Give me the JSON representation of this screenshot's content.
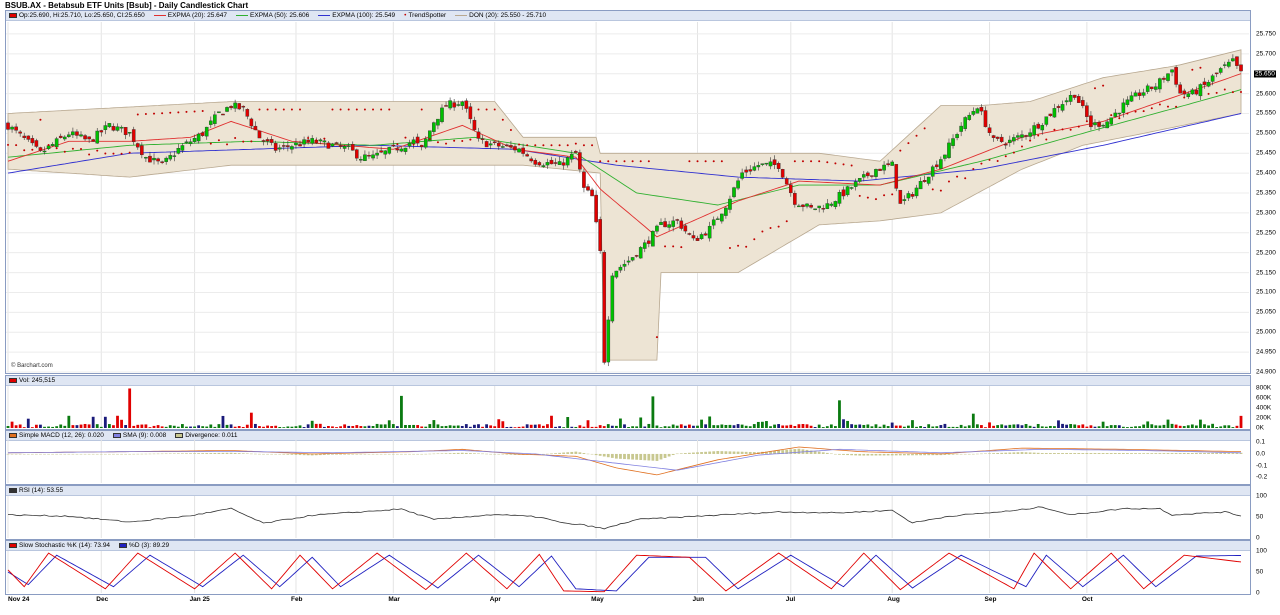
{
  "title": "BSUB.AX - Betabsub ETF Units [Bsub] - Daily Candlestick Chart",
  "legend_price": {
    "ohlc": "Op:25.690, Hi:25.710, Lo:25.650, Cl:25.650",
    "ema": "EXPMA (20): 25.647",
    "ema50": "EXPMA (50): 25.606",
    "ema100": "EXPMA (100): 25.549",
    "trend": "TrendSpotter",
    "don": "DON (20): 25.550 - 25.710"
  },
  "legend_vol": "Vol: 245,515",
  "legend_macd": {
    "macd": "Simple MACD (12, 26): 0.020",
    "sma": "SMA (9): 0.008",
    "div": "Divergence: 0.011"
  },
  "legend_rsi": "RSI (14): 53.55",
  "legend_stoch": {
    "k": "Slow Stochastic %K (14): 73.94",
    "d": "%D (3): 89.29"
  },
  "credit": "© Barchart.com",
  "last_price_label": "25.650",
  "colors": {
    "up": "#00c000",
    "down": "#e00000",
    "ema20": "#e03030",
    "ema50": "#30b030",
    "ema100": "#3030d0",
    "donchian_fill": "#ede4d4",
    "donchian_line": "#b8a890",
    "sar": "#c00000",
    "vol_neutral": "#0a7a10",
    "vol_navy": "#1a1a7a",
    "macd_hist": "#c8c890",
    "macd_line": "#e07020",
    "macd_sig": "#8080e0",
    "rsi": "#333333",
    "stoch_k": "#e00000",
    "stoch_d": "#2020c0"
  },
  "axes": {
    "price_ticks": [
      "25.750",
      "25.700",
      "25.650",
      "25.600",
      "25.550",
      "25.500",
      "25.450",
      "25.400",
      "25.350",
      "25.300",
      "25.250",
      "25.200",
      "25.150",
      "25.100",
      "25.050",
      "25.000",
      "24.950",
      "24.900"
    ],
    "vol_ticks": [
      "800K",
      "600K",
      "400K",
      "200K",
      "0K"
    ],
    "macd_ticks": [
      "0.1",
      "0.0",
      "-0.1",
      "-0.2"
    ],
    "rsi_ticks": [
      "100",
      "50",
      "0"
    ],
    "stoch_ticks": [
      "100",
      "50",
      "0"
    ],
    "x_labels": [
      "Nov 24",
      "Dec",
      "Jan 25",
      "Feb",
      "Mar",
      "Apr",
      "May",
      "Jun",
      "Jul",
      "Aug",
      "Sep",
      "Oct"
    ]
  },
  "chart_data": {
    "type": "candlestick",
    "title": "BSUB.AX - Betabsub ETF Units [Bsub] - Daily Candlestick Chart",
    "price_range": [
      24.9,
      25.78
    ],
    "x_months": [
      "Nov 24",
      "Dec",
      "Jan 25",
      "Feb",
      "Mar",
      "Apr",
      "May",
      "Jun",
      "Jul",
      "Aug",
      "Sep",
      "Oct"
    ],
    "close_path": [
      [
        0,
        25.52
      ],
      [
        8,
        25.45
      ],
      [
        15,
        25.5
      ],
      [
        20,
        25.48
      ],
      [
        25,
        25.52
      ],
      [
        30,
        25.5
      ],
      [
        34,
        25.44
      ],
      [
        38,
        25.42
      ],
      [
        42,
        25.46
      ],
      [
        48,
        25.5
      ],
      [
        52,
        25.55
      ],
      [
        55,
        25.57
      ],
      [
        58,
        25.56
      ],
      [
        62,
        25.49
      ],
      [
        66,
        25.46
      ],
      [
        70,
        25.47
      ],
      [
        75,
        25.48
      ],
      [
        80,
        25.47
      ],
      [
        84,
        25.46
      ],
      [
        87,
        25.44
      ],
      [
        90,
        25.44
      ],
      [
        95,
        25.46
      ],
      [
        100,
        25.48
      ],
      [
        102,
        25.46
      ],
      [
        105,
        25.53
      ],
      [
        108,
        25.57
      ],
      [
        112,
        25.58
      ],
      [
        116,
        25.48
      ],
      [
        120,
        25.47
      ],
      [
        126,
        25.46
      ],
      [
        130,
        25.43
      ],
      [
        136,
        25.42
      ],
      [
        140,
        25.45
      ],
      [
        142,
        25.36
      ],
      [
        144,
        25.34
      ],
      [
        146,
        25.2
      ],
      [
        147,
        24.93
      ],
      [
        149,
        25.15
      ],
      [
        153,
        25.18
      ],
      [
        157,
        25.22
      ],
      [
        161,
        25.27
      ],
      [
        165,
        25.28
      ],
      [
        169,
        25.23
      ],
      [
        173,
        25.26
      ],
      [
        177,
        25.32
      ],
      [
        181,
        25.4
      ],
      [
        185,
        25.42
      ],
      [
        190,
        25.42
      ],
      [
        194,
        25.33
      ],
      [
        198,
        25.31
      ],
      [
        202,
        25.32
      ],
      [
        206,
        25.35
      ],
      [
        210,
        25.38
      ],
      [
        214,
        25.41
      ],
      [
        218,
        25.42
      ],
      [
        220,
        25.32
      ],
      [
        223,
        25.35
      ],
      [
        227,
        25.4
      ],
      [
        231,
        25.45
      ],
      [
        235,
        25.52
      ],
      [
        239,
        25.57
      ],
      [
        243,
        25.48
      ],
      [
        247,
        25.48
      ],
      [
        251,
        25.5
      ],
      [
        255,
        25.53
      ],
      [
        259,
        25.57
      ],
      [
        263,
        25.6
      ],
      [
        267,
        25.52
      ],
      [
        271,
        25.53
      ],
      [
        275,
        25.57
      ],
      [
        279,
        25.6
      ],
      [
        283,
        25.62
      ],
      [
        287,
        25.66
      ],
      [
        289,
        25.6
      ],
      [
        292,
        25.6
      ],
      [
        295,
        25.62
      ],
      [
        299,
        25.66
      ],
      [
        302,
        25.68
      ],
      [
        304,
        25.65
      ]
    ],
    "ema20_path": [
      [
        0,
        25.43
      ],
      [
        15,
        25.48
      ],
      [
        30,
        25.48
      ],
      [
        45,
        25.49
      ],
      [
        55,
        25.53
      ],
      [
        70,
        25.48
      ],
      [
        95,
        25.46
      ],
      [
        112,
        25.52
      ],
      [
        125,
        25.46
      ],
      [
        140,
        25.44
      ],
      [
        146,
        25.36
      ],
      [
        160,
        25.24
      ],
      [
        180,
        25.33
      ],
      [
        195,
        25.38
      ],
      [
        215,
        25.37
      ],
      [
        230,
        25.41
      ],
      [
        250,
        25.49
      ],
      [
        270,
        25.53
      ],
      [
        290,
        25.6
      ],
      [
        304,
        25.65
      ]
    ],
    "ema50_path": [
      [
        0,
        25.44
      ],
      [
        30,
        25.47
      ],
      [
        60,
        25.48
      ],
      [
        90,
        25.47
      ],
      [
        115,
        25.49
      ],
      [
        140,
        25.45
      ],
      [
        155,
        25.35
      ],
      [
        175,
        25.32
      ],
      [
        195,
        25.37
      ],
      [
        215,
        25.37
      ],
      [
        240,
        25.43
      ],
      [
        265,
        25.5
      ],
      [
        290,
        25.57
      ],
      [
        304,
        25.61
      ]
    ],
    "ema100_path": [
      [
        0,
        25.4
      ],
      [
        30,
        25.45
      ],
      [
        60,
        25.46
      ],
      [
        90,
        25.47
      ],
      [
        125,
        25.46
      ],
      [
        150,
        25.42
      ],
      [
        180,
        25.39
      ],
      [
        210,
        25.38
      ],
      [
        240,
        25.41
      ],
      [
        270,
        25.47
      ],
      [
        304,
        25.55
      ]
    ],
    "donchian_upper": [
      [
        0,
        25.55
      ],
      [
        55,
        25.58
      ],
      [
        120,
        25.58
      ],
      [
        127,
        25.49
      ],
      [
        145,
        25.49
      ],
      [
        146,
        25.45
      ],
      [
        182,
        25.45
      ],
      [
        200,
        25.45
      ],
      [
        215,
        25.43
      ],
      [
        230,
        25.57
      ],
      [
        240,
        25.57
      ],
      [
        252,
        25.58
      ],
      [
        270,
        25.64
      ],
      [
        288,
        25.67
      ],
      [
        304,
        25.71
      ]
    ],
    "donchian_lower": [
      [
        0,
        25.41
      ],
      [
        30,
        25.39
      ],
      [
        55,
        25.42
      ],
      [
        80,
        25.42
      ],
      [
        105,
        25.42
      ],
      [
        127,
        25.42
      ],
      [
        146,
        25.4
      ],
      [
        147,
        24.93
      ],
      [
        160,
        24.93
      ],
      [
        161,
        25.15
      ],
      [
        180,
        25.15
      ],
      [
        200,
        25.27
      ],
      [
        215,
        25.28
      ],
      [
        230,
        25.3
      ],
      [
        250,
        25.41
      ],
      [
        265,
        25.47
      ],
      [
        280,
        25.5
      ],
      [
        304,
        25.55
      ]
    ],
    "volume_range": [
      0,
      850000
    ],
    "volume_spikes": [
      [
        30,
        800000
      ],
      [
        60,
        310000
      ],
      [
        97,
        650000
      ],
      [
        159,
        640000
      ],
      [
        205,
        560000
      ],
      [
        218,
        110000
      ],
      [
        238,
        290000
      ],
      [
        286,
        170000
      ],
      [
        304,
        245515
      ]
    ],
    "macd_range": [
      -0.25,
      0.12
    ],
    "macd_series": [
      [
        0,
        0.01
      ],
      [
        30,
        0.02
      ],
      [
        55,
        0.03
      ],
      [
        75,
        0.0
      ],
      [
        100,
        0.02
      ],
      [
        112,
        0.04
      ],
      [
        125,
        0.0
      ],
      [
        140,
        -0.02
      ],
      [
        150,
        -0.12
      ],
      [
        160,
        -0.18
      ],
      [
        175,
        -0.05
      ],
      [
        195,
        0.06
      ],
      [
        210,
        0.02
      ],
      [
        230,
        0.0
      ],
      [
        250,
        0.05
      ],
      [
        275,
        0.04
      ],
      [
        304,
        0.02
      ]
    ],
    "macd_signal": [
      [
        0,
        0.01
      ],
      [
        30,
        0.02
      ],
      [
        60,
        0.02
      ],
      [
        80,
        0.01
      ],
      [
        112,
        0.03
      ],
      [
        130,
        0.0
      ],
      [
        150,
        -0.08
      ],
      [
        165,
        -0.14
      ],
      [
        185,
        -0.01
      ],
      [
        205,
        0.04
      ],
      [
        230,
        0.01
      ],
      [
        255,
        0.04
      ],
      [
        280,
        0.03
      ],
      [
        304,
        0.01
      ]
    ],
    "rsi_range": [
      0,
      100
    ],
    "rsi_series": [
      [
        0,
        55
      ],
      [
        15,
        52
      ],
      [
        30,
        38
      ],
      [
        45,
        53
      ],
      [
        55,
        70
      ],
      [
        63,
        35
      ],
      [
        75,
        54
      ],
      [
        97,
        69
      ],
      [
        105,
        44
      ],
      [
        120,
        56
      ],
      [
        131,
        50
      ],
      [
        137,
        35
      ],
      [
        142,
        31
      ],
      [
        147,
        22
      ],
      [
        155,
        44
      ],
      [
        170,
        52
      ],
      [
        190,
        62
      ],
      [
        205,
        60
      ],
      [
        218,
        66
      ],
      [
        223,
        36
      ],
      [
        232,
        52
      ],
      [
        248,
        65
      ],
      [
        255,
        74
      ],
      [
        262,
        55
      ],
      [
        275,
        70
      ],
      [
        284,
        70
      ],
      [
        287,
        55
      ],
      [
        300,
        62
      ],
      [
        304,
        53
      ]
    ],
    "stoch_range": [
      0,
      100
    ],
    "stoch_k": [
      [
        0,
        55
      ],
      [
        4,
        15
      ],
      [
        10,
        95
      ],
      [
        24,
        10
      ],
      [
        32,
        95
      ],
      [
        46,
        10
      ],
      [
        56,
        95
      ],
      [
        65,
        10
      ],
      [
        72,
        90
      ],
      [
        80,
        10
      ],
      [
        91,
        95
      ],
      [
        103,
        8
      ],
      [
        113,
        95
      ],
      [
        123,
        10
      ],
      [
        131,
        92
      ],
      [
        137,
        5
      ],
      [
        147,
        3
      ],
      [
        155,
        90
      ],
      [
        168,
        85
      ],
      [
        177,
        5
      ],
      [
        190,
        95
      ],
      [
        203,
        10
      ],
      [
        211,
        95
      ],
      [
        220,
        8
      ],
      [
        232,
        95
      ],
      [
        248,
        10
      ],
      [
        253,
        95
      ],
      [
        262,
        10
      ],
      [
        272,
        95
      ],
      [
        280,
        10
      ],
      [
        290,
        90
      ],
      [
        304,
        73.94
      ]
    ],
    "stoch_d": [
      [
        0,
        50
      ],
      [
        5,
        20
      ],
      [
        12,
        90
      ],
      [
        26,
        15
      ],
      [
        35,
        90
      ],
      [
        48,
        15
      ],
      [
        58,
        90
      ],
      [
        67,
        15
      ],
      [
        75,
        85
      ],
      [
        82,
        15
      ],
      [
        94,
        90
      ],
      [
        106,
        12
      ],
      [
        116,
        90
      ],
      [
        126,
        15
      ],
      [
        134,
        88
      ],
      [
        140,
        10
      ],
      [
        150,
        5
      ],
      [
        158,
        85
      ],
      [
        172,
        85
      ],
      [
        180,
        10
      ],
      [
        193,
        90
      ],
      [
        206,
        15
      ],
      [
        214,
        90
      ],
      [
        223,
        12
      ],
      [
        235,
        90
      ],
      [
        251,
        15
      ],
      [
        256,
        90
      ],
      [
        265,
        15
      ],
      [
        275,
        90
      ],
      [
        283,
        15
      ],
      [
        293,
        88
      ],
      [
        304,
        89.29
      ]
    ]
  }
}
